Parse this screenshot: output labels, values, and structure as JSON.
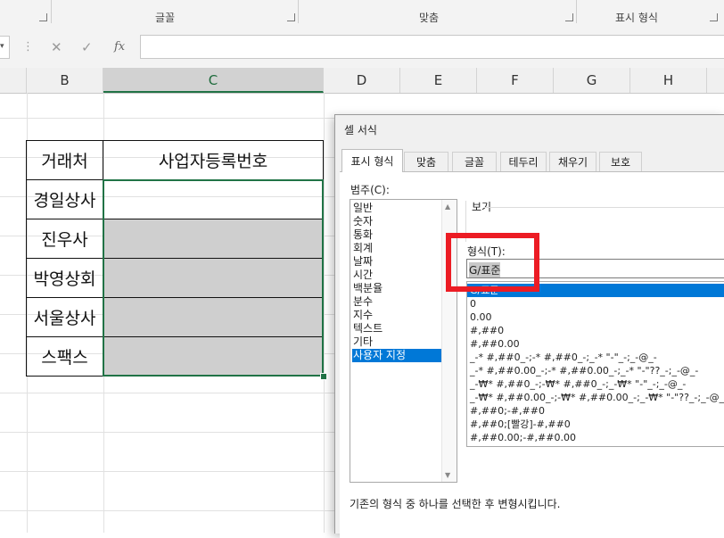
{
  "ribbon": {
    "groups": [
      "글꼴",
      "맞춤",
      "표시 형식"
    ]
  },
  "formula_bar": {
    "cancel_icon": "✕",
    "enter_icon": "✓",
    "fx_label": "fx",
    "more_icon": "⋮",
    "value": ""
  },
  "columns": [
    "B",
    "C",
    "D",
    "E",
    "F",
    "G",
    "H"
  ],
  "selected_column": "C",
  "table": {
    "header_name": "거래처",
    "header_number": "사업자등록번호",
    "rows": [
      {
        "name": "경일상사",
        "number": ""
      },
      {
        "name": "진우사",
        "number": ""
      },
      {
        "name": "박영상회",
        "number": ""
      },
      {
        "name": "서울상사",
        "number": ""
      },
      {
        "name": "스팩스",
        "number": ""
      }
    ]
  },
  "dialog": {
    "title": "셀 서식",
    "tabs": [
      "표시 형식",
      "맞춤",
      "글꼴",
      "테두리",
      "채우기",
      "보호"
    ],
    "active_tab": "표시 형식",
    "category_label": "범주(C):",
    "categories": [
      "일반",
      "숫자",
      "통화",
      "회계",
      "날짜",
      "시간",
      "백분율",
      "분수",
      "지수",
      "텍스트",
      "기타",
      "사용자 지정"
    ],
    "selected_category": "사용자 지정",
    "preview_label": "보기",
    "type_label": "형식(T):",
    "type_value": "G/표준",
    "type_list": [
      "G/표준",
      "0",
      "0.00",
      "#,##0",
      "#,##0.00",
      "_-* #,##0_-;-* #,##0_-;_-* \"-\"_-;_-@_-",
      "_-* #,##0.00_-;-* #,##0.00_-;_-* \"-\"??_-;_-@_-",
      "_-₩* #,##0_-;-₩* #,##0_-;_-₩* \"-\"_-;_-@_-",
      "_-₩* #,##0.00_-;-₩* #,##0.00_-;_-₩* \"-\"??_-;_-@_-",
      "#,##0;-#,##0",
      "#,##0;[빨강]-#,##0",
      "#,##0.00;-#,##0.00"
    ],
    "selected_type": "G/표준",
    "description": "기존의 형식 중 하나를 선택한 후 변형시킵니다."
  },
  "colors": {
    "selection_green": "#217346",
    "highlight_red": "#ec1c24",
    "list_selection": "#0078d7"
  }
}
